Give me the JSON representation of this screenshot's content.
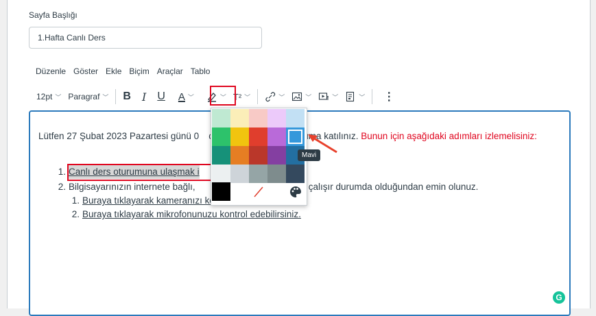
{
  "page_title_label": "Sayfa Başlığı",
  "page_title_value": "1.Hafta Canlı Ders",
  "menu": [
    "Düzenle",
    "Göster",
    "Ekle",
    "Biçim",
    "Araçlar",
    "Tablo"
  ],
  "toolbar": {
    "font_size": "12pt",
    "block_format": "Paragraf",
    "bold": "B",
    "italic": "I",
    "underline": "U",
    "text_color_glyph": "A",
    "superscript": "T²"
  },
  "content": {
    "intro_start": "Lütfen 27 Şubat 2023 Pazartesi günü 0",
    "intro_end": "ceğimiz eşzamanlı oturuma katılınız. ",
    "intro_red": "Bunun için aşağıdaki adımları izlemelisiniz:",
    "item1_num": "1.",
    "item1_text": "Canlı ders oturumuna ulaşmak i",
    "item2_num": "2.",
    "item2_start": "Bilgisayarınızın internete bağlı, ",
    "item2_end": "zın çalışır durumda olduğundan emin olunuz.",
    "sub1_num": "1.",
    "sub1_text": "Buraya tıklayarak kameranızı kontrol edebilirsiniz.",
    "sub2_num": "2.",
    "sub2_text": "Buraya tıklayarak mikrofonunuzu kontrol edebilirsiniz."
  },
  "palette": {
    "colors": [
      "#bfe9d2",
      "#fbeeb8",
      "#f8cac6",
      "#eccafa",
      "#c2e0f4",
      "#2dc26b",
      "#f1c40f",
      "#e03e2d",
      "#b96ad9",
      "#3598db",
      "#169179",
      "#e67e23",
      "#ba372a",
      "#843fa1",
      "#236fa1",
      "#ecf0f1",
      "#ced4d9",
      "#95a5a6",
      "#7e8c8d",
      "#34495e"
    ],
    "black": "#000000",
    "selected": "Mavi"
  },
  "tooltip": "Mavi",
  "grammarly_glyph": "G"
}
